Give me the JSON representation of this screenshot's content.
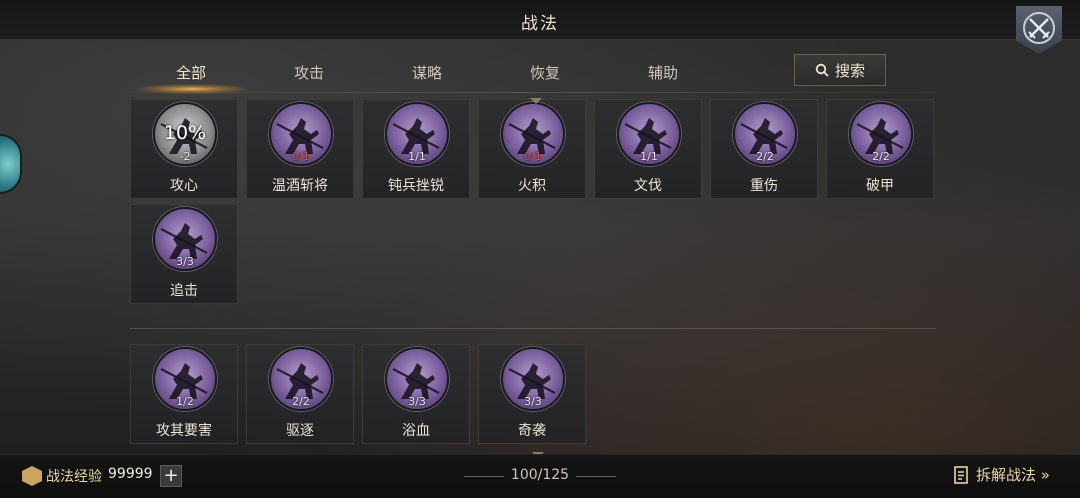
{
  "header": {
    "title": "战法"
  },
  "tabs": [
    {
      "label": "全部",
      "active": true
    },
    {
      "label": "攻击",
      "active": false
    },
    {
      "label": "谋略",
      "active": false
    },
    {
      "label": "恢复",
      "active": false
    },
    {
      "label": "辅助",
      "active": false
    }
  ],
  "search": {
    "label": "搜索",
    "icon": "search-icon"
  },
  "group1": [
    {
      "name": "攻心",
      "count": "-2",
      "count_color": "white",
      "progress": "10%",
      "style": "gray"
    },
    {
      "name": "温酒斩将",
      "count": "0/1",
      "count_color": "red"
    },
    {
      "name": "钝兵挫锐",
      "count": "1/1",
      "count_color": "white"
    },
    {
      "name": "火积",
      "count": "0/1",
      "count_color": "red"
    },
    {
      "name": "文伐",
      "count": "1/1",
      "count_color": "white"
    },
    {
      "name": "重伤",
      "count": "2/2",
      "count_color": "white"
    },
    {
      "name": "破甲",
      "count": "2/2",
      "count_color": "white"
    },
    {
      "name": "追击",
      "count": "3/3",
      "count_color": "white"
    }
  ],
  "group2": [
    {
      "name": "攻其要害",
      "count": "1/2",
      "count_color": "white"
    },
    {
      "name": "驱逐",
      "count": "2/2",
      "count_color": "white"
    },
    {
      "name": "浴血",
      "count": "3/3",
      "count_color": "white"
    },
    {
      "name": "奇袭",
      "count": "3/3",
      "count_color": "white"
    }
  ],
  "footer": {
    "exp_label": "战法经验",
    "exp_value": "99999",
    "plus_label": "+",
    "page_count": "100/125",
    "decompose_label": "拆解战法 »"
  },
  "colors": {
    "accent": "#e8d6a6",
    "medal_purple": "#7a5e9d",
    "count_red": "#e04a3f"
  }
}
